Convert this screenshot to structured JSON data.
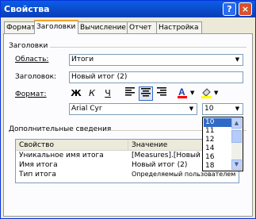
{
  "window": {
    "title": "Свойства",
    "help_label": "?",
    "close_label": "×"
  },
  "tabs": [
    {
      "label": "Формат"
    },
    {
      "label": "Заголовки",
      "active": true
    },
    {
      "label": "Вычисление"
    },
    {
      "label": "Отчет"
    },
    {
      "label": "Настройка"
    }
  ],
  "section_headers": {
    "main": "Заголовки",
    "extra": "Дополнительные сведения"
  },
  "area": {
    "label": "Область:",
    "value": "Итоги"
  },
  "caption": {
    "label": "Заголовок:",
    "value": "Новый итог (2)"
  },
  "format": {
    "label": "Формат:",
    "bold": "Ж",
    "italic": "К",
    "underline": "Ч",
    "font_family": "Arial Cyr",
    "font_size": "10",
    "font_color": "#ff0000",
    "fill_color": "#ffff00"
  },
  "size_options": [
    "10",
    "11",
    "12",
    "14",
    "16",
    "18"
  ],
  "size_selected": "10",
  "details": {
    "headers": [
      "Свойство",
      "Значение"
    ],
    "rows": [
      {
        "property": "Уникальное имя итога",
        "value": "[Measures].[Новый"
      },
      {
        "property": "Имя итога",
        "value": "Новый итог (2)"
      },
      {
        "property": "Тип итога",
        "value": "Определяемый пользователем"
      }
    ]
  }
}
